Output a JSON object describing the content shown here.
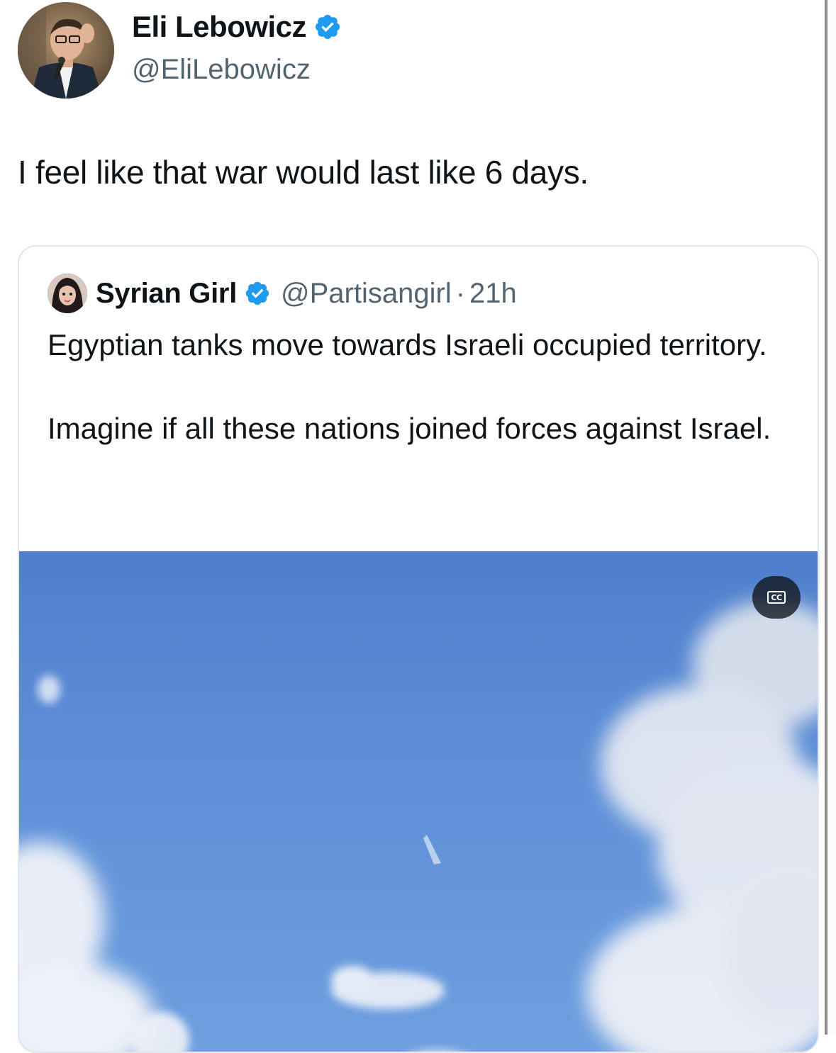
{
  "tweet": {
    "author_name": "Eli Lebowicz",
    "author_handle": "@EliLebowicz",
    "text": "I feel like that war would last like 6 days."
  },
  "quoted_tweet": {
    "author_name": "Syrian Girl",
    "author_handle": "@Partisangirl",
    "separator": "·",
    "time": "21h",
    "paragraphs": [
      "Egyptian tanks move towards Israeli occupied territory.",
      "Imagine if all these nations joined forces against Israel."
    ],
    "media": {
      "type": "video",
      "caption_button_label": "CC"
    }
  },
  "icons": {
    "verified": "verified-badge-icon",
    "captions": "closed-captions-icon"
  },
  "colors": {
    "verified_blue": "#1d9bf0",
    "text_primary": "#0f1419",
    "text_secondary": "#536471",
    "card_border": "#e1e8ed",
    "sky_blue": "#5b8fd6"
  }
}
